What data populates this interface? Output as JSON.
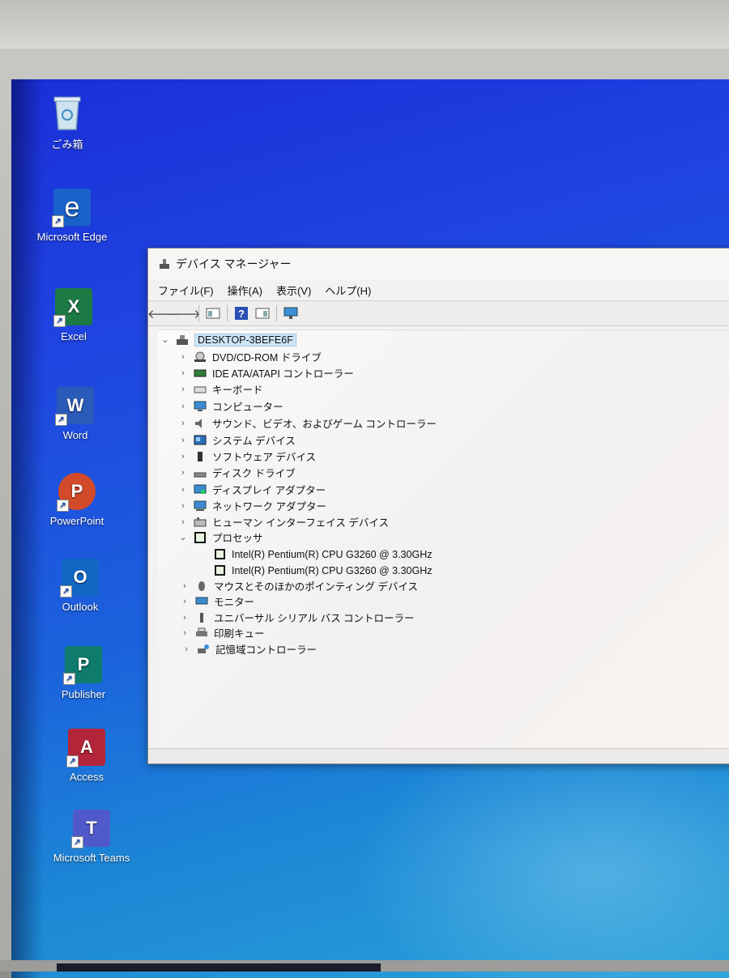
{
  "desktop": {
    "icons": [
      {
        "label": "ごみ箱",
        "icon": "recycle-bin-icon"
      },
      {
        "label": "Microsoft Edge",
        "icon": "edge-icon",
        "glyph": "e",
        "color": "#1a62c9"
      },
      {
        "label": "Excel",
        "icon": "excel-icon",
        "glyph": "X",
        "color": "#1e7a45"
      },
      {
        "label": "Word",
        "icon": "word-icon",
        "glyph": "W",
        "color": "#2b5bb8"
      },
      {
        "label": "PowerPoint",
        "icon": "powerpoint-icon",
        "glyph": "P",
        "color": "#d24a2a"
      },
      {
        "label": "Outlook",
        "icon": "outlook-icon",
        "glyph": "O",
        "color": "#1267c4"
      },
      {
        "label": "Publisher",
        "icon": "publisher-icon",
        "glyph": "P",
        "color": "#0f7b6c"
      },
      {
        "label": "Access",
        "icon": "access-icon",
        "glyph": "A",
        "color": "#b3263a"
      },
      {
        "label": "Microsoft Teams",
        "icon": "teams-icon",
        "glyph": "T",
        "color": "#5059c9"
      }
    ]
  },
  "window": {
    "title": "デバイス マネージャー",
    "menu": [
      "ファイル(F)",
      "操作(A)",
      "表示(V)",
      "ヘルプ(H)"
    ],
    "toolbar": [
      "back-arrow-icon",
      "forward-arrow-icon",
      "properties-icon",
      "help-icon",
      "view-icon",
      "scan-hardware-icon"
    ]
  },
  "tree": {
    "root": "DESKTOP-3BEFE6F",
    "categories": [
      {
        "label": "DVD/CD-ROM ドライブ",
        "icon": "dvd-drive-icon"
      },
      {
        "label": "IDE ATA/ATAPI コントローラー",
        "icon": "ide-controller-icon"
      },
      {
        "label": "キーボード",
        "icon": "keyboard-icon"
      },
      {
        "label": "コンピューター",
        "icon": "computer-icon"
      },
      {
        "label": "サウンド、ビデオ、およびゲーム コントローラー",
        "icon": "speaker-icon"
      },
      {
        "label": "システム デバイス",
        "icon": "system-device-icon"
      },
      {
        "label": "ソフトウェア デバイス",
        "icon": "software-device-icon"
      },
      {
        "label": "ディスク ドライブ",
        "icon": "disk-drive-icon"
      },
      {
        "label": "ディスプレイ アダプター",
        "icon": "display-adapter-icon"
      },
      {
        "label": "ネットワーク アダプター",
        "icon": "network-adapter-icon"
      },
      {
        "label": "ヒューマン インターフェイス デバイス",
        "icon": "hid-icon"
      },
      {
        "label": "プロセッサ",
        "icon": "processor-icon",
        "expanded": true,
        "children": [
          "Intel(R) Pentium(R) CPU G3260 @ 3.30GHz",
          "Intel(R) Pentium(R) CPU G3260 @ 3.30GHz"
        ]
      },
      {
        "label": "マウスとそのほかのポインティング デバイス",
        "icon": "mouse-icon"
      },
      {
        "label": "モニター",
        "icon": "monitor-icon"
      },
      {
        "label": "ユニバーサル シリアル バス コントローラー",
        "icon": "usb-icon"
      },
      {
        "label": "印刷キュー",
        "icon": "printer-icon"
      },
      {
        "label": "記憶域コントローラー",
        "icon": "storage-controller-icon"
      }
    ]
  }
}
